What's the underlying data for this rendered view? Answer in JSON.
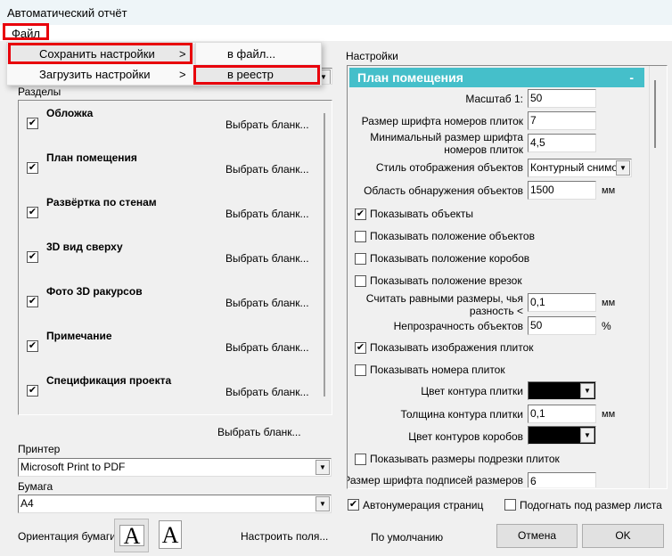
{
  "window": {
    "title": "Автоматический отчёт"
  },
  "menu": {
    "file": "Файл",
    "items": [
      {
        "label": "Сохранить настройки",
        "arrow": ">"
      },
      {
        "label": "Загрузить настройки",
        "arrow": ">"
      }
    ],
    "submenu": [
      "в файл...",
      "в реестр"
    ]
  },
  "left": {
    "sections_label": "Разделы",
    "sections": [
      {
        "title": "Обложка",
        "checked": true,
        "pick": "Выбрать бланк..."
      },
      {
        "title": "План помещения",
        "checked": true,
        "pick": "Выбрать бланк..."
      },
      {
        "title": "Развёртка по стенам",
        "checked": true,
        "pick": "Выбрать бланк..."
      },
      {
        "title": "3D вид сверху",
        "checked": true,
        "pick": "Выбрать бланк..."
      },
      {
        "title": "Фото 3D ракурсов",
        "checked": true,
        "pick": "Выбрать бланк..."
      },
      {
        "title": "Примечание",
        "checked": true,
        "pick": "Выбрать бланк..."
      },
      {
        "title": "Спецификация проекта",
        "checked": true,
        "pick": "Выбрать бланк..."
      }
    ],
    "pick_all": "Выбрать бланк...",
    "printer_label": "Принтер",
    "printer": "Microsoft Print to PDF",
    "paper_label": "Бумага",
    "paper": "A4",
    "orientation_label": "Ориентация бумаги",
    "orientation_glyph": "A",
    "margins": "Настроить поля..."
  },
  "right": {
    "settings_label": "Настройки",
    "panel_title": "План помещения",
    "collapse": "-",
    "scale_label": "Масштаб 1:",
    "scale": "50",
    "font_label": "Размер шрифта номеров плиток",
    "font": "7",
    "minfont_label1": "Минимальный размер шрифта",
    "minfont_label2": "номеров плиток",
    "minfont": "4,5",
    "style_label": "Стиль отображения объектов",
    "style": "Контурный снимок",
    "area_label": "Область обнаружения объектов",
    "area": "1500",
    "area_unit": "мм",
    "show_objects": "Показывать объекты",
    "show_obj_pos": "Показывать положение объектов",
    "show_box_pos": "Показывать положение коробов",
    "show_cut_pos": "Показывать положение врезок",
    "equal_label1": "Считать равными размеры, чья",
    "equal_label2": "разность <",
    "equal": "0,1",
    "equal_unit": "мм",
    "opacity_label": "Непрозрачность объектов",
    "opacity": "50",
    "opacity_unit": "%",
    "show_tile_img": "Показывать изображения плиток",
    "show_tile_num": "Показывать номера плиток",
    "tile_color_label": "Цвет контура плитки",
    "tile_color": "#000000",
    "tile_thick_label": "Толщина контура плитки",
    "tile_thick": "0,1",
    "tile_thick_unit": "мм",
    "box_color_label": "Цвет контуров коробов",
    "box_color": "#000000",
    "show_trim": "Показывать размеры подрезки плиток",
    "caption_font_label": "Размер шрифта подписей размеров",
    "caption_font": "6"
  },
  "bottom": {
    "autonum": "Автонумерация страниц",
    "fit": "Подогнать под размер листа",
    "default": "По умолчанию",
    "cancel": "Отмена",
    "ok": "OK"
  },
  "colors": {
    "header": "#45bfca",
    "highlight": "#e8000b"
  }
}
